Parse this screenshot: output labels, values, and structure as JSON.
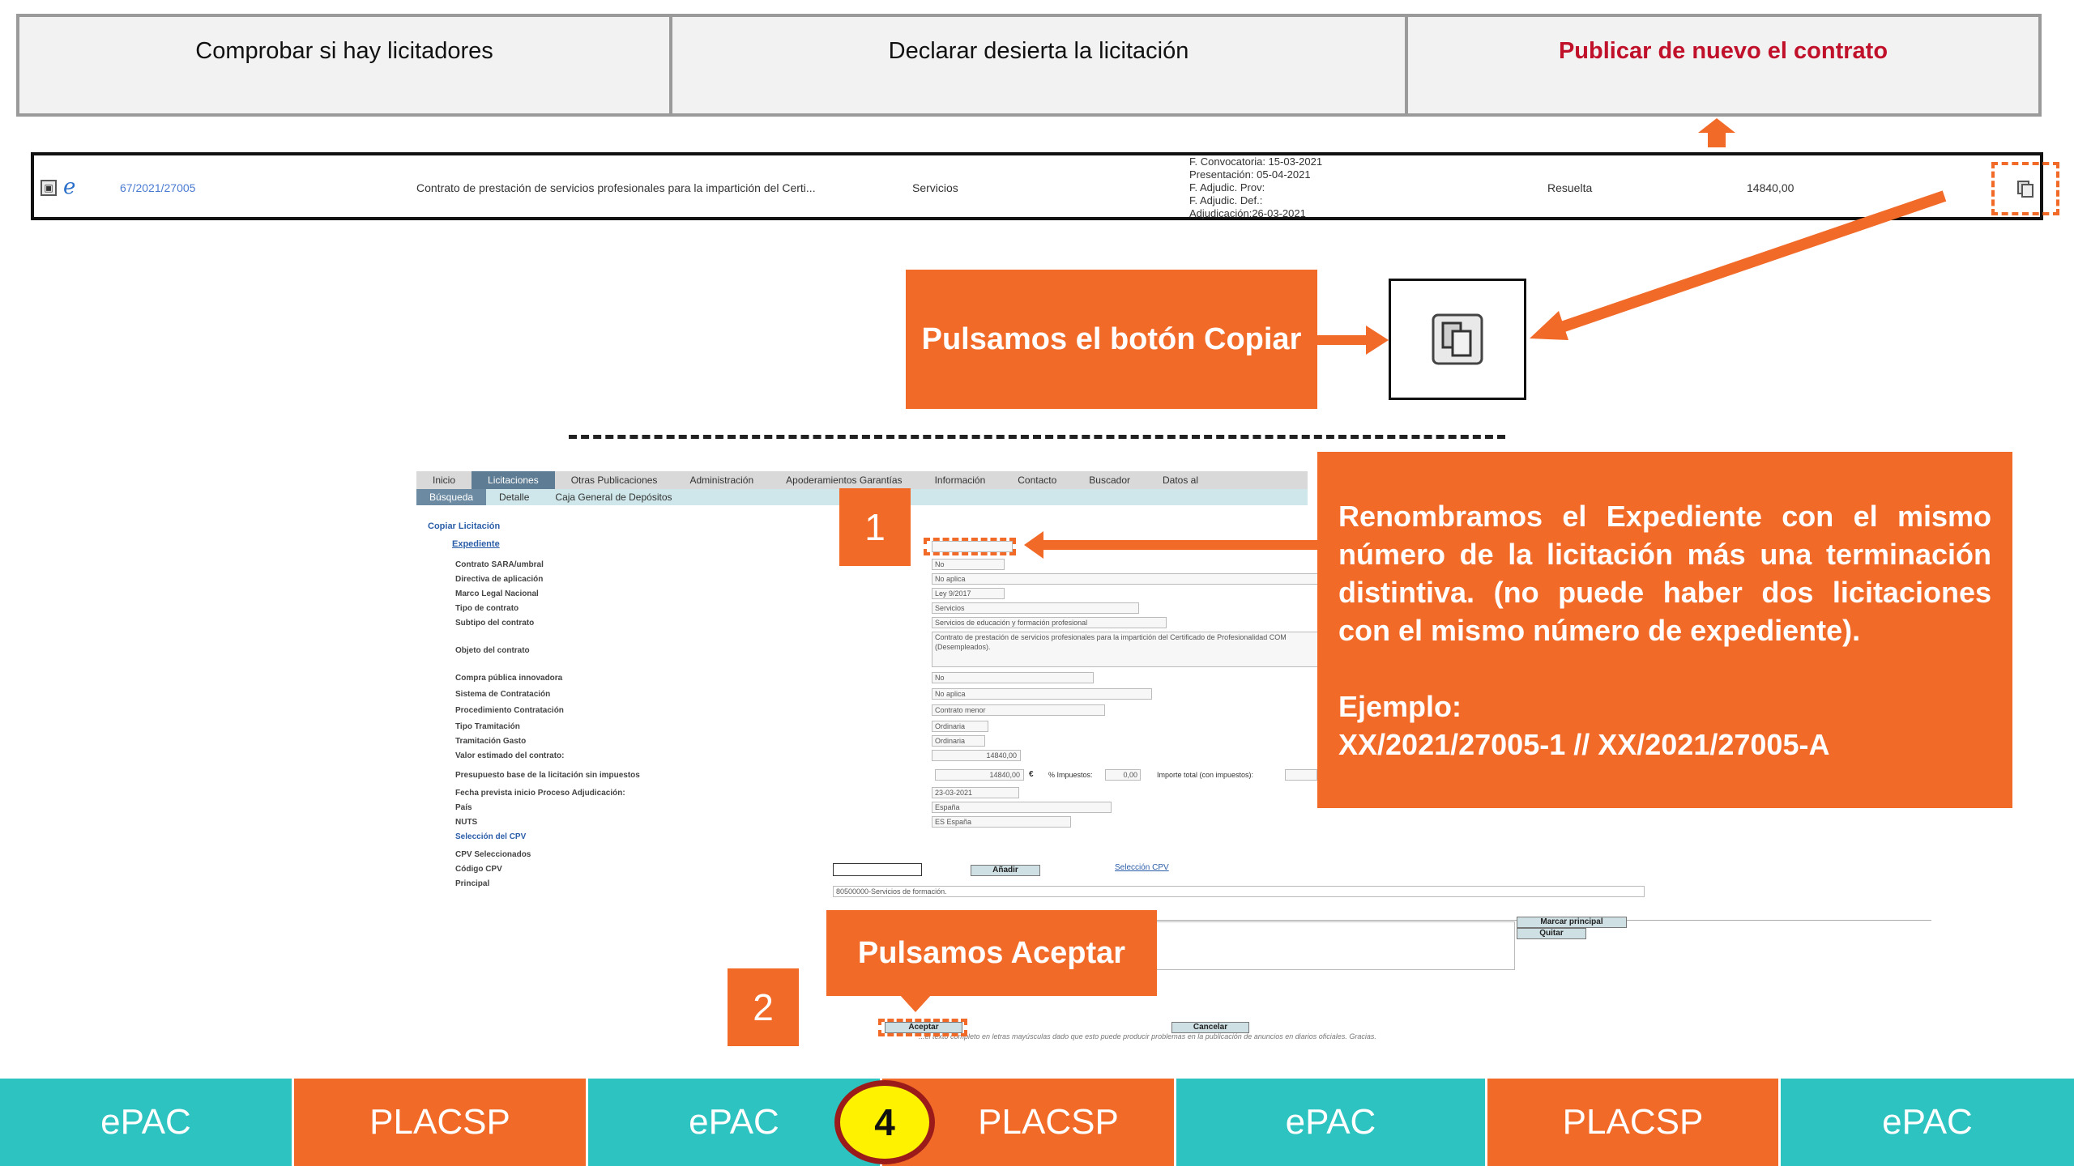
{
  "steps": [
    {
      "label": "Comprobar si hay licitadores"
    },
    {
      "label": "Declarar desierta la licitación"
    },
    {
      "label": "Publicar de nuevo el contrato"
    }
  ],
  "result_row": {
    "id": "67/2021/27005",
    "description": "Contrato de prestación de servicios profesionales para la impartición del Certi...",
    "type": "Servicios",
    "dates": [
      "F. Convocatoria: 15-03-2021",
      "Presentación: 05-04-2021",
      "F. Adjudic. Prov:",
      "F. Adjudic. Def.:",
      "Adjudicación:26-03-2021"
    ],
    "status": "Resuelta",
    "amount": "14840,00"
  },
  "callouts": {
    "copiar": "Pulsamos el botón Copiar",
    "rename_text": "Renombramos el Expediente con el mismo número de la licitación más una terminación distintiva. (no puede haber dos licitaciones con el mismo número de expediente).",
    "ejemplo_title": "Ejemplo:",
    "ejemplo_value": "XX/2021/27005-1  // XX/2021/27005-A",
    "aceptar": "Pulsamos Aceptar",
    "num1": "1",
    "num2": "2"
  },
  "form": {
    "nav_main": [
      "Inicio",
      "Licitaciones",
      "Otras Publicaciones",
      "Administración",
      "Apoderamientos Garantías",
      "Información",
      "Contacto",
      "Buscador",
      "Datos al"
    ],
    "nav_sub": [
      "Búsqueda",
      "Detalle",
      "Caja General de Depósitos"
    ],
    "title": "Copiar Licitación",
    "section": "Expediente",
    "labels": [
      "Contrato SARA/umbral",
      "Directiva de aplicación",
      "Marco Legal Nacional",
      "Tipo de contrato",
      "Subtipo del contrato",
      "Objeto del contrato",
      "Compra pública innovadora",
      "Sistema de Contratación",
      "Procedimiento Contratación",
      "Tipo Tramitación",
      "Tramitación Gasto",
      "Valor estimado del contrato:",
      "Presupuesto base de la licitación sin impuestos",
      "Fecha prevista inicio Proceso Adjudicación:",
      "País",
      "NUTS"
    ],
    "values": {
      "sara": "No",
      "directiva": "No aplica",
      "marco": "Ley 9/2017",
      "tipo": "Servicios",
      "subtipo": "Servicios de educación y formación profesional",
      "objeto": "Contrato de prestación de servicios profesionales para la impartición del Certificado de Profesionalidad COM (Desempleados).",
      "compra": "No",
      "sistema": "No aplica",
      "procedimiento": "Contrato menor",
      "tipo_tram": "Ordinaria",
      "tram_gasto": "Ordinaria",
      "valor": "14840,00",
      "presupuesto": "14840,00",
      "currency": "€",
      "impuestos_label": "% Impuestos:",
      "impuestos": "0,00",
      "importe_total_label": "Importe total (con impuestos):",
      "fecha": "23-03-2021",
      "pais": "España",
      "nuts": "ES España"
    },
    "cpv_title": "Selección del CPV",
    "cpv_selected": "CPV Seleccionados",
    "cpv_code_label": "Código CPV",
    "cpv_principal": "Principal",
    "anadir": "Añadir",
    "seleccion_cpv_link": "Selección CPV",
    "cpv_item": "80500000-Servicios de formación.",
    "marcar_principal": "Marcar principal",
    "quitar": "Quitar",
    "aceptar": "Aceptar",
    "cancelar": "Cancelar",
    "footer": "...el texto completo en letras mayúsculas dado que esto puede producir problemas en la publicación de anuncios en diarios oficiales. Gracias."
  },
  "bottom_bar": {
    "items": [
      "ePAC",
      "PLACSP",
      "ePAC",
      "PLACSP",
      "ePAC",
      "PLACSP",
      "ePAC"
    ],
    "step_number": "4"
  },
  "colors": {
    "orange": "#f26a28",
    "teal": "#2cc3c0",
    "red_text": "#c0102a",
    "yellow": "#fff200"
  }
}
